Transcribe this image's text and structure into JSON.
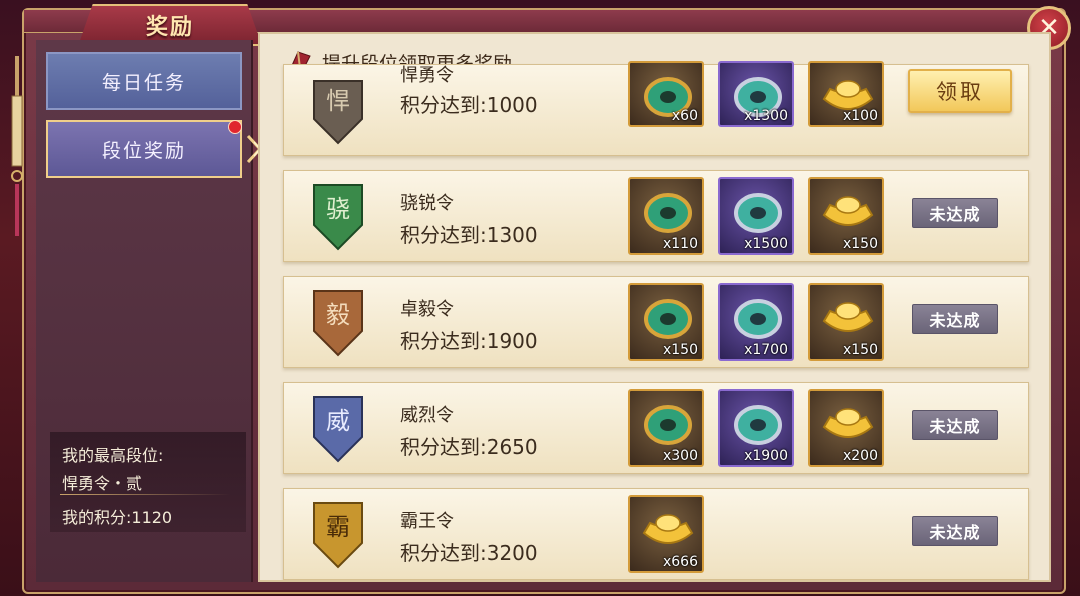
{
  "window": {
    "title": "奖励",
    "close_glyph": "✕"
  },
  "sidebar": {
    "tabs": [
      {
        "label": "每日任务",
        "active": false
      },
      {
        "label": "段位奖励",
        "active": true,
        "has_notification": true
      }
    ],
    "rank_info": {
      "best_rank_label": "我的最高段位:",
      "best_rank_value": "悍勇令・贰",
      "score_label": "我的积分:1120"
    }
  },
  "main": {
    "header_text": "提升段位领取更多奖励",
    "rows": [
      {
        "badge_char": "悍",
        "badge_color": "#6a5e52",
        "name": "悍勇令",
        "score_text": "积分达到:1000",
        "items": [
          {
            "type": "jade-ring-gold",
            "qty": "x60"
          },
          {
            "type": "jade-ring-purple",
            "qty": "x1300"
          },
          {
            "type": "gold-ingot",
            "qty": "x100"
          }
        ],
        "button": {
          "label": "领取",
          "state": "claimable"
        }
      },
      {
        "badge_char": "骁",
        "badge_color": "#3a8a4a",
        "name": "骁锐令",
        "score_text": "积分达到:1300",
        "items": [
          {
            "type": "jade-ring-gold",
            "qty": "x110"
          },
          {
            "type": "jade-ring-purple",
            "qty": "x1500"
          },
          {
            "type": "gold-ingot",
            "qty": "x150"
          }
        ],
        "button": {
          "label": "未达成",
          "state": "unmet"
        }
      },
      {
        "badge_char": "毅",
        "badge_color": "#a8683a",
        "name": "卓毅令",
        "score_text": "积分达到:1900",
        "items": [
          {
            "type": "jade-ring-gold",
            "qty": "x150"
          },
          {
            "type": "jade-ring-purple",
            "qty": "x1700"
          },
          {
            "type": "gold-ingot",
            "qty": "x150"
          }
        ],
        "button": {
          "label": "未达成",
          "state": "unmet"
        }
      },
      {
        "badge_char": "威",
        "badge_color": "#5a6aa8",
        "name": "威烈令",
        "score_text": "积分达到:2650",
        "items": [
          {
            "type": "jade-ring-gold",
            "qty": "x300"
          },
          {
            "type": "jade-ring-purple",
            "qty": "x1900"
          },
          {
            "type": "gold-ingot",
            "qty": "x200"
          }
        ],
        "button": {
          "label": "未达成",
          "state": "unmet"
        }
      },
      {
        "badge_char": "霸",
        "badge_color": "#c8962e",
        "name": "霸王令",
        "score_text": "积分达到:3200",
        "items": [
          {
            "type": "gold-ingot",
            "qty": "x666"
          }
        ],
        "button": {
          "label": "未达成",
          "state": "unmet"
        }
      }
    ]
  },
  "colors": {
    "frame": "#5c2a38",
    "accent_gold": "#e5c07a",
    "panel_bg": "#f0e6d2",
    "unmet_button": "#7a7488",
    "claim_button": "#f2c85a"
  }
}
